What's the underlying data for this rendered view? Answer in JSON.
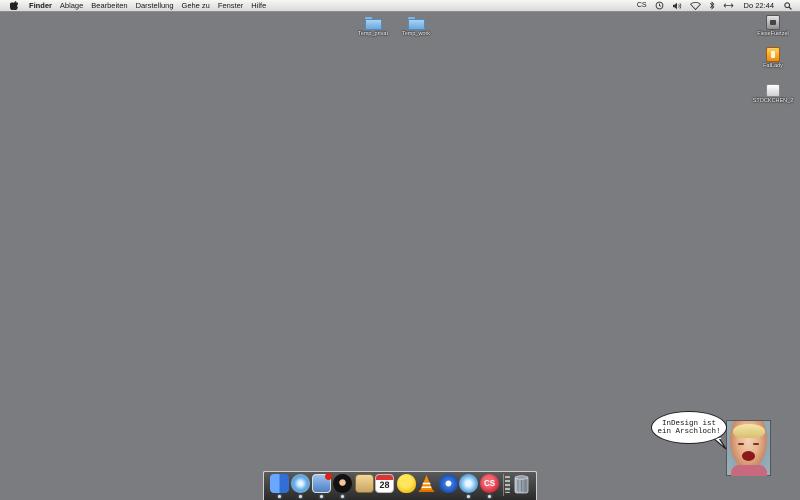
{
  "menubar": {
    "app_name": "Finder",
    "menus": [
      "Ablage",
      "Bearbeiten",
      "Darstellung",
      "Gehe zu",
      "Fenster",
      "Hilfe"
    ],
    "status_cs": "CS",
    "clock": "Do 22:44"
  },
  "desktop": {
    "top_icons": [
      {
        "label": "Temp_privat",
        "icon": "folder-icon"
      },
      {
        "label": "Temp_work",
        "icon": "folder-icon"
      }
    ],
    "right_icons": [
      {
        "label": "FieseFuetzel",
        "icon": "drive-icon"
      },
      {
        "label": "FatLady",
        "icon": "drive-icon"
      },
      {
        "label": "STOCKCHEN_2",
        "icon": "drive-icon"
      }
    ]
  },
  "widget": {
    "bubble_line1": "InDesign ist",
    "bubble_line2": "ein Arschloch!"
  },
  "dock": {
    "items": [
      "finder-icon",
      "safari-icon",
      "mail-icon",
      "ninja-icon",
      "notes-icon",
      "ical-icon",
      "cyberduck-icon",
      "vlc-icon",
      "quicktime-icon",
      "itunes-icon",
      "creative-suite-icon",
      "stack-icon",
      "trash-icon"
    ],
    "ical_date": "28",
    "cs_label": "CS"
  },
  "colors": {
    "desktop": "#7b7c7f",
    "menubar": "#e8e8e8",
    "folder": "#8cc0ea",
    "dock": "#3a3a3a"
  }
}
